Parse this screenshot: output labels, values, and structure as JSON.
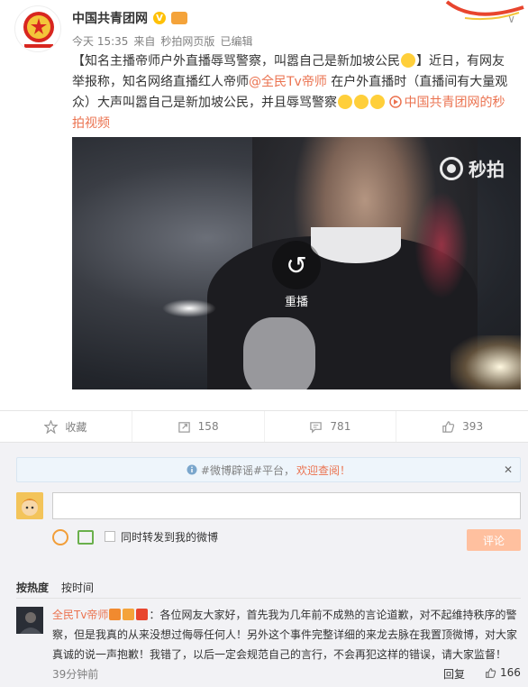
{
  "post": {
    "author": "中国共青团网",
    "time": "今天 15:35",
    "source_prefix": "来自",
    "source": "秒拍网页版",
    "edited": "已编辑",
    "text_before_emoji": "【知名主播帝师户外直播辱骂警察，叫嚣自己是新加坡公民",
    "text_mid": "】近日，有网友举报称，知名网络直播红人帝师",
    "mention": "@全民Tv帝师",
    "text_after": " 在户外直播时（直播间有大量观众）大声叫嚣自己是新加坡公民，并且辱骂警察",
    "video_link": "中国共青团网的秒拍视频"
  },
  "video": {
    "watermark": "秒拍",
    "replay_label": "重播"
  },
  "actions": {
    "favorite": "收藏",
    "repost": "158",
    "comment": "781",
    "like": "393"
  },
  "comment_box": {
    "notice_text": "#微博辟谣#平台，",
    "notice_link": "欢迎查阅！",
    "input_value": "",
    "forward_label": "同时转发到我的微博",
    "submit": "评论"
  },
  "sort": {
    "hot": "按热度",
    "time": "按时间"
  },
  "comments": [
    {
      "name": "全民Tv帝师",
      "text": "：各位网友大家好，首先我为几年前不成熟的言论道歉，对不起维持秩序的警察，但是我真的从来没想过侮辱任何人！另外这个事件完整详细的来龙去脉在我置顶微博，对大家真诚的说一声抱歉！我错了，以后一定会规范自己的言行，不会再犯这样的错误，请大家监督！",
      "time": "39分钟前",
      "reply": "回复",
      "likes": "166"
    }
  ],
  "colors": {
    "link": "#eb7350",
    "meta": "#808080",
    "submit_bg": "#ffc09f"
  }
}
